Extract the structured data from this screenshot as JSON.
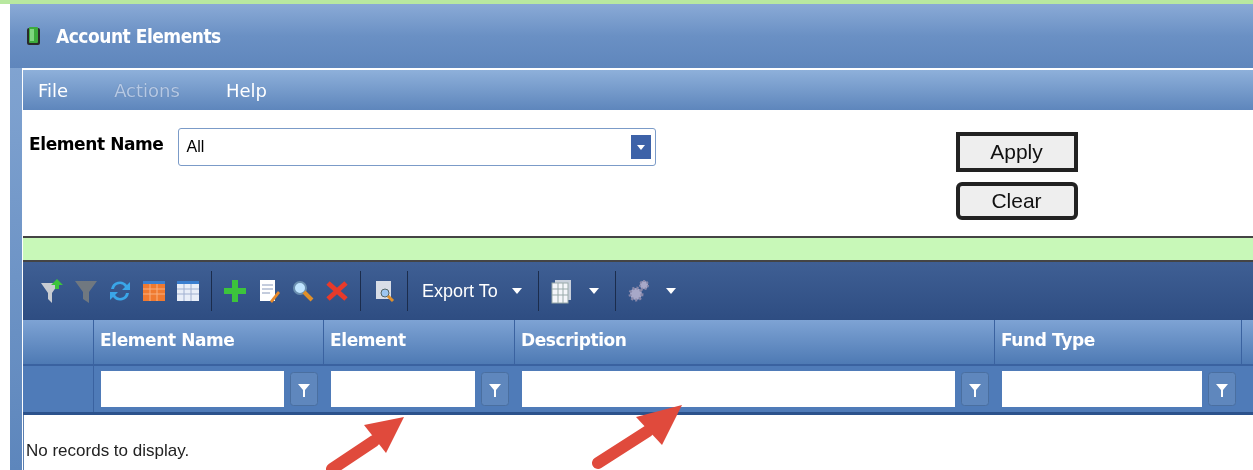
{
  "window": {
    "title": "Account Elements"
  },
  "menu": [
    {
      "label": "File",
      "disabled": false
    },
    {
      "label": "Actions",
      "disabled": true
    },
    {
      "label": "Help",
      "disabled": false
    }
  ],
  "filter": {
    "label": "Element Name",
    "value": "All",
    "buttons": [
      {
        "label": "Apply",
        "kind": "square"
      },
      {
        "label": "Clear",
        "kind": "rounded"
      }
    ]
  },
  "toolbar": {
    "export_label": "Export To"
  },
  "table": {
    "columns": [
      {
        "label": "Element Name"
      },
      {
        "label": "Element"
      },
      {
        "label": "Description"
      },
      {
        "label": "Fund Type"
      }
    ],
    "empty_message": "No records to display."
  }
}
